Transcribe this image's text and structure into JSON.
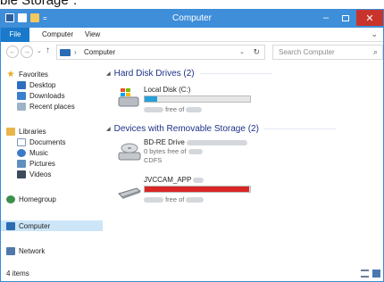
{
  "caption_text": "ble Storage\".",
  "window": {
    "title": "Computer",
    "tabs": [
      "File",
      "Computer",
      "View"
    ]
  },
  "address": {
    "crumb": "Computer",
    "search_placeholder": "Search Computer"
  },
  "nav": {
    "favorites": "Favorites",
    "desktop": "Desktop",
    "downloads": "Downloads",
    "recent_places": "Recent places",
    "libraries": "Libraries",
    "documents": "Documents",
    "music": "Music",
    "pictures": "Pictures",
    "videos": "Videos",
    "homegroup": "Homegroup",
    "computer": "Computer",
    "network": "Network"
  },
  "groups": {
    "hdd": "Hard Disk Drives (2)",
    "removable": "Devices with Removable Storage (2)"
  },
  "drives": {
    "local": {
      "name": "Local Disk (C:)",
      "free_text": "free of",
      "used_fraction": 0.12,
      "bar_color": "#26a0da"
    },
    "bd": {
      "name": "BD-RE Drive",
      "free_text": "0 bytes free of",
      "fs": "CDFS"
    },
    "jvc": {
      "name": "JVCCAM_APP",
      "free_text": "free of",
      "used_fraction": 0.99,
      "bar_color": "#da2626"
    }
  },
  "status": {
    "items": "4 items"
  },
  "colors": {
    "accent": "#3e8ed9",
    "group_header": "#1e3287",
    "selection": "#cde6f7"
  }
}
